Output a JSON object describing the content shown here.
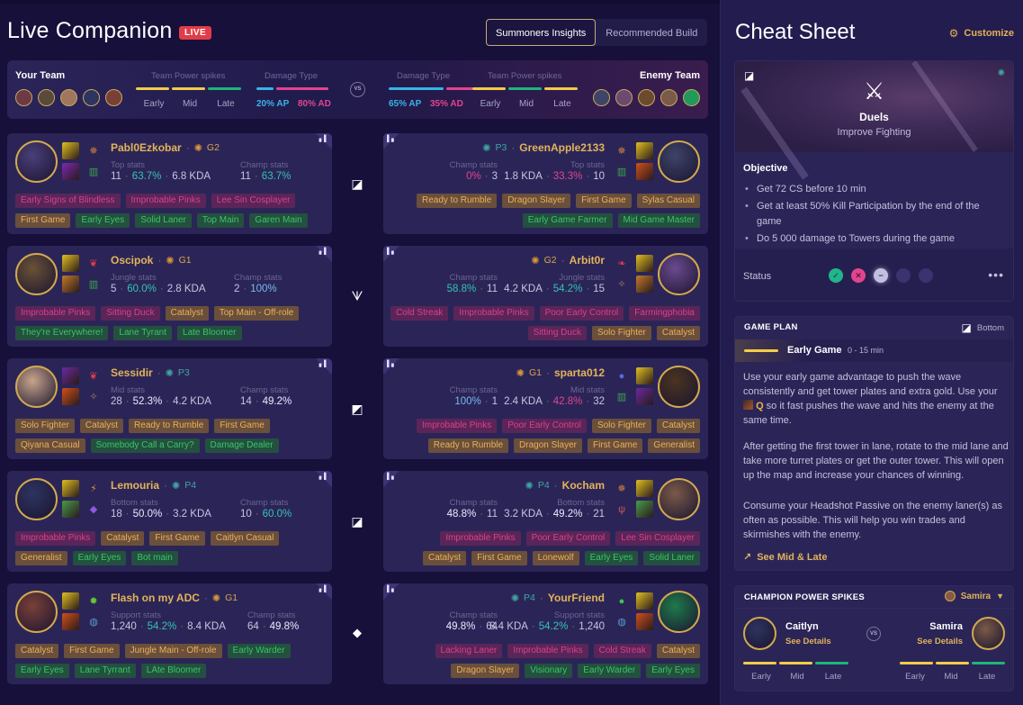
{
  "app": {
    "title": "Live Companion",
    "live_badge": "LIVE",
    "tabs": [
      {
        "label": "Summoners Insights",
        "active": true
      },
      {
        "label": "Recommended Build",
        "active": false
      }
    ]
  },
  "team_summary": {
    "your_team": {
      "label": "Your Team",
      "power_spikes_label": "Team Power spikes",
      "power_spikes": [
        {
          "phase": "Early",
          "color": "#f2cd48"
        },
        {
          "phase": "Mid",
          "color": "#f2cd48"
        },
        {
          "phase": "Late",
          "color": "#1fb57a"
        }
      ],
      "damage_label": "Damage Type",
      "damage": {
        "ap": "20% AP",
        "ad": "80% AD",
        "ap_fraction": 0.2,
        "ad_fraction": 0.8
      },
      "avatar_colors": [
        "#6b3a44",
        "#5a4a3a",
        "#a0765e",
        "#2e3460",
        "#7a4038"
      ]
    },
    "vs_label": "VS",
    "enemy_team": {
      "label": "Enemy Team",
      "power_spikes_label": "Team Power spikes",
      "power_spikes": [
        {
          "phase": "Early",
          "color": "#f2cd48"
        },
        {
          "phase": "Mid",
          "color": "#1fb57a"
        },
        {
          "phase": "Late",
          "color": "#f2cd48"
        }
      ],
      "damage_label": "Damage Type",
      "damage": {
        "ap": "65% AP",
        "ad": "35% AD",
        "ap_fraction": 0.65,
        "ad_fraction": 0.35
      },
      "avatar_colors": [
        "#3e4468",
        "#6a4a6e",
        "#6b4a2e",
        "#7a5a48",
        "#1f9a5a"
      ]
    }
  },
  "colors": {
    "ap": "#39b3e6",
    "ad": "#e0458e",
    "gold": "#e2b25a",
    "teal": "#35c3b0"
  },
  "lanes": [
    {
      "icon": "top-lane-icon",
      "glyph": "◪"
    },
    {
      "icon": "jungle-icon",
      "glyph": "ᗐ"
    },
    {
      "icon": "mid-lane-icon",
      "glyph": "◩"
    },
    {
      "icon": "bottom-lane-icon",
      "glyph": "◪"
    },
    {
      "icon": "support-icon",
      "glyph": "⯁"
    }
  ],
  "players_left": [
    {
      "name": "Pabl0Ezkobar",
      "rank": "G2",
      "rank_tier": "gold",
      "portrait_color": "#4a3f7a",
      "spells": [
        "#e0c020",
        "#7a2ab0"
      ],
      "runes": [
        {
          "g": "✵",
          "c": "#e08a3a"
        },
        {
          "g": "▥",
          "c": "#3aa84a"
        }
      ],
      "role_stats_label": "Top stats",
      "role_stats": [
        {
          "v": "11",
          "c": ""
        },
        {
          "v": "63.7%",
          "c": "teal"
        },
        {
          "v": "6.8 KDA",
          "c": ""
        }
      ],
      "champ_stats_label": "Champ stats",
      "champ_stats": [
        {
          "v": "11",
          "c": ""
        },
        {
          "v": "63.7%",
          "c": "teal"
        }
      ],
      "tags_row1": [
        {
          "t": "Early Signs of Blindless",
          "k": "pink"
        },
        {
          "t": "Improbable Pinks",
          "k": "pink"
        },
        {
          "t": "Lee Sin Cosplayer",
          "k": "pink"
        }
      ],
      "tags_row2": [
        {
          "t": "First Game",
          "k": "gold"
        },
        {
          "t": "Early Eyes",
          "k": "green"
        },
        {
          "t": "Solid Laner",
          "k": "green"
        },
        {
          "t": "Top Main",
          "k": "green"
        },
        {
          "t": "Garen Main",
          "k": "green"
        }
      ]
    },
    {
      "name": "Oscipok",
      "rank": "G1",
      "rank_tier": "gold",
      "portrait_color": "#6a5236",
      "spells": [
        "#e0c020",
        "#c27a2a"
      ],
      "runes": [
        {
          "g": "❦",
          "c": "#e03a4a"
        },
        {
          "g": "▥",
          "c": "#3aa84a"
        }
      ],
      "role_stats_label": "Jungle stats",
      "role_stats": [
        {
          "v": "5",
          "c": ""
        },
        {
          "v": "60.0%",
          "c": "teal"
        },
        {
          "v": "2.8 KDA",
          "c": ""
        }
      ],
      "champ_stats_label": "Champ stats",
      "champ_stats": [
        {
          "v": "2",
          "c": ""
        },
        {
          "v": "100%",
          "c": "blue"
        }
      ],
      "tags_row1": [
        {
          "t": "Improbable Pinks",
          "k": "pink"
        },
        {
          "t": "Sitting Duck",
          "k": "pink"
        },
        {
          "t": "Catalyst",
          "k": "gold"
        },
        {
          "t": "Top Main - Off-role",
          "k": "gold"
        }
      ],
      "tags_row2": [
        {
          "t": "They're Everywhere!",
          "k": "green"
        },
        {
          "t": "Lane Tyrant",
          "k": "green"
        },
        {
          "t": "Late Bloomer",
          "k": "green"
        }
      ]
    },
    {
      "name": "Sessidir",
      "rank": "P3",
      "rank_tier": "platinum",
      "portrait_color": "#c8a58a",
      "spells": [
        "#6a2aa0",
        "#d0501a"
      ],
      "runes": [
        {
          "g": "❦",
          "c": "#e03a4a"
        },
        {
          "g": "✧",
          "c": "#a8885a"
        }
      ],
      "role_stats_label": "Mid stats",
      "role_stats": [
        {
          "v": "28",
          "c": ""
        },
        {
          "v": "52.3%",
          "c": "white"
        },
        {
          "v": "4.2 KDA",
          "c": ""
        }
      ],
      "champ_stats_label": "Champ stats",
      "champ_stats": [
        {
          "v": "14",
          "c": ""
        },
        {
          "v": "49.2%",
          "c": "white"
        }
      ],
      "tags_row1": [
        {
          "t": "Solo Fighter",
          "k": "gold"
        },
        {
          "t": "Catalyst",
          "k": "gold"
        },
        {
          "t": "Ready to Rumble",
          "k": "gold"
        },
        {
          "t": "First Game",
          "k": "gold"
        }
      ],
      "tags_row2": [
        {
          "t": "Qiyana Casual",
          "k": "gold"
        },
        {
          "t": "Somebody Call a Carry?",
          "k": "green"
        },
        {
          "t": "Damage Dealer",
          "k": "green"
        }
      ]
    },
    {
      "name": "Lemouria",
      "rank": "P4",
      "rank_tier": "platinum",
      "portrait_color": "#2e3460",
      "spells": [
        "#e0c020",
        "#4a9a4a"
      ],
      "runes": [
        {
          "g": "⚡",
          "c": "#e08a3a"
        },
        {
          "g": "◆",
          "c": "#8a5ae0"
        }
      ],
      "role_stats_label": "Bottom stats",
      "role_stats": [
        {
          "v": "18",
          "c": ""
        },
        {
          "v": "50.0%",
          "c": "white"
        },
        {
          "v": "3.2 KDA",
          "c": ""
        }
      ],
      "champ_stats_label": "Champ stats",
      "champ_stats": [
        {
          "v": "10",
          "c": ""
        },
        {
          "v": "60.0%",
          "c": "teal"
        }
      ],
      "tags_row1": [
        {
          "t": "Improbable Pinks",
          "k": "pink"
        },
        {
          "t": "Catalyst",
          "k": "gold"
        },
        {
          "t": "First Game",
          "k": "gold"
        },
        {
          "t": "Caitlyn Casual",
          "k": "gold"
        }
      ],
      "tags_row2": [
        {
          "t": "Generalist",
          "k": "gold"
        },
        {
          "t": "Early Eyes",
          "k": "green"
        },
        {
          "t": "Bot main",
          "k": "green"
        }
      ]
    },
    {
      "name": "Flash on my ADC",
      "rank": "G1",
      "rank_tier": "gold",
      "portrait_color": "#7a4038",
      "spells": [
        "#e0c020",
        "#d0501a"
      ],
      "runes": [
        {
          "g": "✹",
          "c": "#6ac83a"
        },
        {
          "g": "◍",
          "c": "#5a9ac8"
        }
      ],
      "role_stats_label": "Support stats",
      "role_stats": [
        {
          "v": "1,240",
          "c": ""
        },
        {
          "v": "54.2%",
          "c": "teal"
        },
        {
          "v": "8.4 KDA",
          "c": ""
        }
      ],
      "champ_stats_label": "Champ stats",
      "champ_stats": [
        {
          "v": "64",
          "c": ""
        },
        {
          "v": "49.8%",
          "c": "white"
        }
      ],
      "tags_row1": [
        {
          "t": "Catalyst",
          "k": "gold"
        },
        {
          "t": "First Game",
          "k": "gold"
        },
        {
          "t": "Jungle Main - Off-role",
          "k": "gold"
        },
        {
          "t": "Early Warder",
          "k": "green"
        }
      ],
      "tags_row2": [
        {
          "t": "Early Eyes",
          "k": "green"
        },
        {
          "t": "Lane Tyrrant",
          "k": "green"
        },
        {
          "t": "LAte Bloomer",
          "k": "green"
        }
      ]
    }
  ],
  "players_right": [
    {
      "name": "GreenApple2133",
      "rank": "P3",
      "rank_tier": "platinum",
      "portrait_color": "#3e4468",
      "spells": [
        "#e0c020",
        "#d0501a"
      ],
      "runes": [
        {
          "g": "✵",
          "c": "#e08a3a"
        },
        {
          "g": "▥",
          "c": "#3aa84a"
        }
      ],
      "role_stats_label": "Top stats",
      "role_stats": [
        {
          "v": "10",
          "c": ""
        },
        {
          "v": "33.3%",
          "c": "pink"
        },
        {
          "v": "1.8 KDA",
          "c": ""
        }
      ],
      "champ_stats_label": "Champ stats",
      "champ_stats": [
        {
          "v": "3",
          "c": ""
        },
        {
          "v": "0%",
          "c": "pink"
        }
      ],
      "tags_row1": [
        {
          "t": "Ready to Rumble",
          "k": "gold"
        },
        {
          "t": "Dragon Slayer",
          "k": "gold"
        },
        {
          "t": "First Game",
          "k": "gold"
        },
        {
          "t": "Sylas Casual",
          "k": "gold"
        }
      ],
      "tags_row2": [
        {
          "t": "Early Game Farmer",
          "k": "green"
        },
        {
          "t": "Mid Game Master",
          "k": "green"
        }
      ]
    },
    {
      "name": "Arbit0r",
      "rank": "G2",
      "rank_tier": "gold",
      "portrait_color": "#6a4a8e",
      "spells": [
        "#e0c020",
        "#c27a2a"
      ],
      "runes": [
        {
          "g": "❧",
          "c": "#e03a4a"
        },
        {
          "g": "✧",
          "c": "#a8885a"
        }
      ],
      "role_stats_label": "Jungle stats",
      "role_stats": [
        {
          "v": "15",
          "c": ""
        },
        {
          "v": "54.2%",
          "c": "teal"
        },
        {
          "v": "4.2 KDA",
          "c": ""
        }
      ],
      "champ_stats_label": "Champ stats",
      "champ_stats": [
        {
          "v": "11",
          "c": ""
        },
        {
          "v": "58.8%",
          "c": "teal"
        }
      ],
      "tags_row1": [
        {
          "t": "Cold Streak",
          "k": "pink"
        },
        {
          "t": "Improbable Pinks",
          "k": "pink"
        },
        {
          "t": "Poor Early Control",
          "k": "pink"
        },
        {
          "t": "Farmingphobia",
          "k": "pink"
        }
      ],
      "tags_row2": [
        {
          "t": "Sitting Duck",
          "k": "pink"
        },
        {
          "t": "Solo Fighter",
          "k": "gold"
        },
        {
          "t": "Catalyst",
          "k": "gold"
        }
      ]
    },
    {
      "name": "sparta012",
      "rank": "G1",
      "rank_tier": "gold",
      "portrait_color": "#4a3420",
      "spells": [
        "#e0c020",
        "#6a2aa0"
      ],
      "runes": [
        {
          "g": "●",
          "c": "#5a6ae0"
        },
        {
          "g": "▥",
          "c": "#3aa84a"
        }
      ],
      "role_stats_label": "Mid stats",
      "role_stats": [
        {
          "v": "32",
          "c": ""
        },
        {
          "v": "42.8%",
          "c": "pink"
        },
        {
          "v": "2.4 KDA",
          "c": ""
        }
      ],
      "champ_stats_label": "Champ stats",
      "champ_stats": [
        {
          "v": "1",
          "c": ""
        },
        {
          "v": "100%",
          "c": "blue"
        }
      ],
      "tags_row1": [
        {
          "t": "Improbable Pinks",
          "k": "pink"
        },
        {
          "t": "Poor Early Control",
          "k": "pink"
        },
        {
          "t": "Solo Fighter",
          "k": "gold"
        },
        {
          "t": "Catalyst",
          "k": "gold"
        }
      ],
      "tags_row2": [
        {
          "t": "Ready to Rumble",
          "k": "gold"
        },
        {
          "t": "Dragon Slayer",
          "k": "gold"
        },
        {
          "t": "First Game",
          "k": "gold"
        },
        {
          "t": "Generalist",
          "k": "gold"
        }
      ]
    },
    {
      "name": "Kocham",
      "rank": "P4",
      "rank_tier": "platinum",
      "portrait_color": "#7a5a48",
      "spells": [
        "#e0c020",
        "#4a9a4a"
      ],
      "runes": [
        {
          "g": "✵",
          "c": "#e08a3a"
        },
        {
          "g": "ψ",
          "c": "#c8585a"
        }
      ],
      "role_stats_label": "Bottom stats",
      "role_stats": [
        {
          "v": "21",
          "c": ""
        },
        {
          "v": "49.2%",
          "c": "white"
        },
        {
          "v": "3.2 KDA",
          "c": ""
        }
      ],
      "champ_stats_label": "Champ stats",
      "champ_stats": [
        {
          "v": "11",
          "c": ""
        },
        {
          "v": "48.8%",
          "c": "white"
        }
      ],
      "tags_row1": [
        {
          "t": "Improbable Pinks",
          "k": "pink"
        },
        {
          "t": "Poor Early Control",
          "k": "pink"
        },
        {
          "t": "Lee Sin Cosplayer",
          "k": "pink"
        }
      ],
      "tags_row2": [
        {
          "t": "Catalyst",
          "k": "gold"
        },
        {
          "t": "First Game",
          "k": "gold"
        },
        {
          "t": "Lonewolf",
          "k": "gold"
        },
        {
          "t": "Early Eyes",
          "k": "green"
        },
        {
          "t": "Solid Laner",
          "k": "green"
        }
      ]
    },
    {
      "name": "YourFriend",
      "rank": "P4",
      "rank_tier": "platinum",
      "portrait_color": "#1f7a4a",
      "spells": [
        "#e0c020",
        "#d0501a"
      ],
      "runes": [
        {
          "g": "●",
          "c": "#3ac84a"
        },
        {
          "g": "◍",
          "c": "#5a9ac8"
        }
      ],
      "role_stats_label": "Support stats",
      "role_stats": [
        {
          "v": "1,240",
          "c": ""
        },
        {
          "v": "54.2%",
          "c": "teal"
        },
        {
          "v": "8.4 KDA",
          "c": ""
        }
      ],
      "champ_stats_label": "Champ stats",
      "champ_stats": [
        {
          "v": "64",
          "c": ""
        },
        {
          "v": "49.8%",
          "c": "white"
        }
      ],
      "tags_row1": [
        {
          "t": "Lacking Laner",
          "k": "pink"
        },
        {
          "t": "Improbable Pinks",
          "k": "pink"
        },
        {
          "t": "Cold Streak",
          "k": "pink"
        },
        {
          "t": "Catalyst",
          "k": "gold"
        }
      ],
      "tags_row2": [
        {
          "t": "Dragon Slayer",
          "k": "gold"
        },
        {
          "t": "Visionary",
          "k": "green"
        },
        {
          "t": "Early Warder",
          "k": "green"
        },
        {
          "t": "Early Eyes",
          "k": "green"
        }
      ]
    }
  ],
  "cheat_sheet": {
    "title": "Cheat Sheet",
    "customize_label": "Customize",
    "objective_card": {
      "focus_title": "Duels",
      "focus_subtitle": "Improve Fighting",
      "objective_heading": "Objective",
      "objectives": [
        "Get 72 CS before 10 min",
        "Get at least 50% Kill Participation by the end of the game",
        "Do 5 000 damage to Towers during the game"
      ],
      "status_label": "Status",
      "status_states": [
        {
          "state": "success",
          "glyph": "✓",
          "bg": "#20b58a",
          "fg": "#0c3a2c"
        },
        {
          "state": "fail",
          "glyph": "✕",
          "bg": "#e0458e",
          "fg": "#3a0c22"
        },
        {
          "state": "neutral",
          "glyph": "−",
          "bg": "#c3bfe0",
          "fg": "#2a2450"
        },
        {
          "state": "empty",
          "glyph": "",
          "bg": "#3a3370",
          "fg": ""
        },
        {
          "state": "empty",
          "glyph": "",
          "bg": "#3a3370",
          "fg": ""
        }
      ],
      "more_label": "•••"
    },
    "game_plan": {
      "heading": "GAME PLAN",
      "lane": "Bottom",
      "phase_name": "Early Game",
      "phase_time": "0 - 15 min",
      "para1_a": "Use your early game advantage to push the wave consistently and get tower plates and extra gold. Use your ",
      "ability_key": "Q",
      "para1_b": " so it fast pushes the wave and hits the enemy at the same time.",
      "para2": "After getting the first tower in lane, rotate to the mid lane and take more turret plates or get the outer tower. This will open up the map and increase your chances of winning.",
      "para3": "Consume your Headshot Passive on the enemy laner(s) as often as possible. This will help you win trades and skirmishes with the enemy.",
      "see_more_label": "See Mid & Late"
    },
    "power_spikes": {
      "heading": "CHAMPION POWER SPIKES",
      "selected": "Samira",
      "vs_label": "VS",
      "left": {
        "name": "Caitlyn",
        "details_label": "See Details",
        "portrait_color": "#2e3460",
        "spikes": [
          {
            "phase": "Early",
            "color": "#f2cd48"
          },
          {
            "phase": "Mid",
            "color": "#f2cd48"
          },
          {
            "phase": "Late",
            "color": "#1fb57a"
          }
        ]
      },
      "right": {
        "name": "Samira",
        "details_label": "See Details",
        "portrait_color": "#7a5a48",
        "spikes": [
          {
            "phase": "Early",
            "color": "#f2cd48"
          },
          {
            "phase": "Mid",
            "color": "#f2cd48"
          },
          {
            "phase": "Late",
            "color": "#1fb57a"
          }
        ]
      }
    }
  }
}
